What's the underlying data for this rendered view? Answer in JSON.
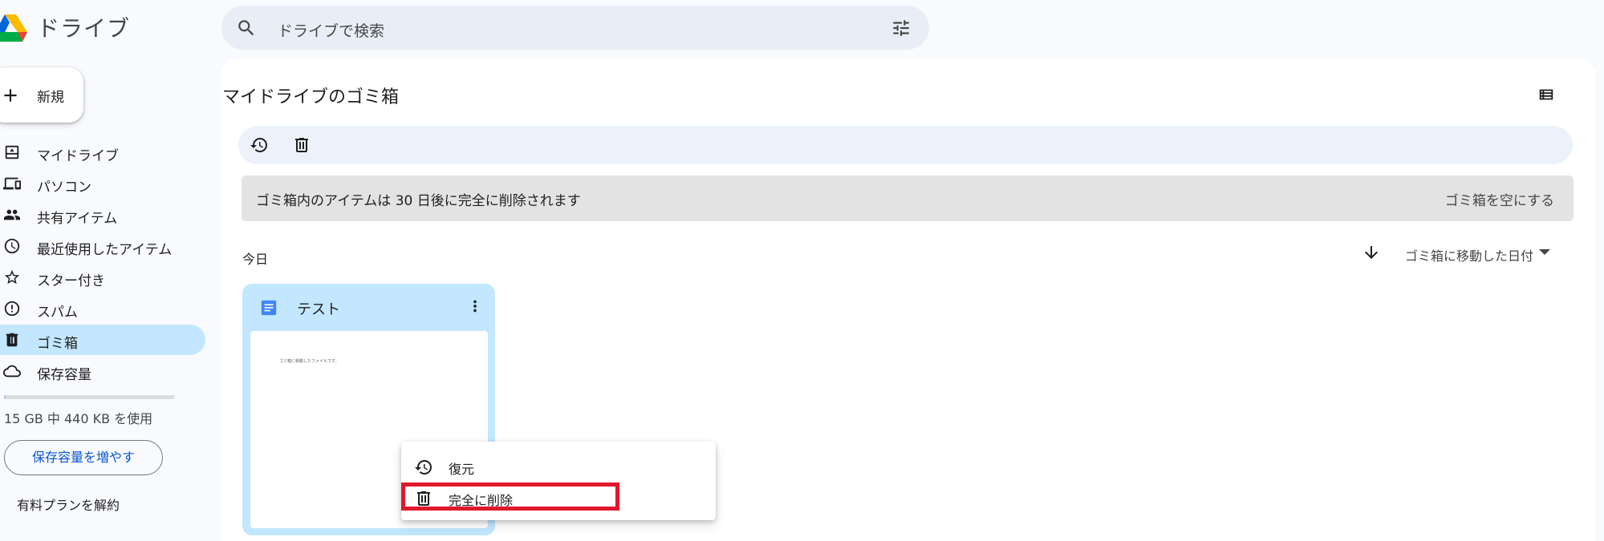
{
  "header": {
    "app_title": "ドライブ",
    "search": {
      "placeholder": "ドライブで検索",
      "icon": "search-icon",
      "filter_icon": "tune-icon"
    }
  },
  "sidebar": {
    "new_button": {
      "label": "新規",
      "icon": "plus-icon"
    },
    "items": [
      {
        "label": "マイドライブ",
        "icon": "my-drive-icon",
        "active": false
      },
      {
        "label": "パソコン",
        "icon": "computers-icon",
        "active": false
      },
      {
        "label": "共有アイテム",
        "icon": "people-icon",
        "active": false
      },
      {
        "label": "最近使用したアイテム",
        "icon": "clock-icon",
        "active": false
      },
      {
        "label": "スター付き",
        "icon": "star-icon",
        "active": false
      },
      {
        "label": "スパム",
        "icon": "spam-icon",
        "active": false
      },
      {
        "label": "ゴミ箱",
        "icon": "trash-icon",
        "active": true
      },
      {
        "label": "保存容量",
        "icon": "cloud-icon",
        "active": false
      }
    ],
    "storage": {
      "usage_text": "15 GB 中 440 KB を使用",
      "used_fraction": 3e-05,
      "upgrade_label": "保存容量を増やす",
      "cancel_label": "有料プランを解約"
    }
  },
  "main": {
    "title": "マイドライブのゴミ箱",
    "toolbar": {
      "restore_icon": "restore-icon",
      "delete_icon": "delete-icon"
    },
    "banner": {
      "text": "ゴミ箱内のアイテムは 30 日後に完全に削除されます",
      "action": "ゴミ箱を空にする"
    },
    "group_label": "今日",
    "sort": {
      "label": "ゴミ箱に移動した日付",
      "direction": "descending"
    },
    "files": [
      {
        "name": "テスト",
        "type": "google-doc",
        "thumb_text": "ゴミ箱に移動したファイルです。"
      }
    ]
  },
  "context_menu": {
    "items": [
      {
        "label": "復元",
        "icon": "restore-icon"
      },
      {
        "label": "完全に削除",
        "icon": "delete-forever-icon",
        "highlighted": true
      }
    ]
  },
  "colors": {
    "background": "#f8fafd",
    "active_nav": "#c2e7ff",
    "selected_card": "#c2e7ff",
    "highlight": "#e0182d",
    "link": "#0b57d0"
  }
}
